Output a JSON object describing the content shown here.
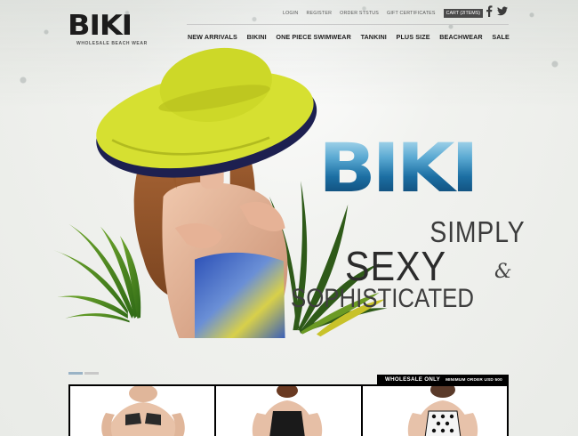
{
  "brand": {
    "logo_text": "BIKI",
    "tagline": "WHOLESALE BEACH WEAR"
  },
  "utility_nav": {
    "items": [
      {
        "label": "LOGIN"
      },
      {
        "label": "REGISTER"
      },
      {
        "label": "ORDER STSTUS"
      },
      {
        "label": "GIFT CERTIFICATES"
      }
    ],
    "cart_label": "CART (2ITEMS)",
    "social": [
      "facebook-icon",
      "twitter-icon"
    ]
  },
  "main_nav": {
    "items": [
      {
        "label": "NEW ARRIVALS"
      },
      {
        "label": "BIKINI"
      },
      {
        "label": "ONE PIECE SWIMWEAR"
      },
      {
        "label": "TANKINI"
      },
      {
        "label": "PLUS SIZE"
      },
      {
        "label": "BEACHWEAR"
      },
      {
        "label": "SALE"
      }
    ]
  },
  "hero": {
    "headline": "BIKI",
    "slogan_line1": "SIMPLY",
    "slogan_line2": "SEXY",
    "slogan_amp": "&",
    "slogan_line3": "SOPHISTICATED",
    "slides": 2,
    "active_slide": 1
  },
  "wholesale": {
    "label": "WHOLESALE ONLY",
    "minimum": "MINIMUM ORDER USD 500"
  },
  "products": [
    {
      "name": "bikini-product-thumb"
    },
    {
      "name": "one-piece-product-thumb"
    },
    {
      "name": "polka-dot-product-thumb"
    }
  ],
  "colors": {
    "hat": "#d6e031",
    "nav_text": "#1d1d1d",
    "brand_blue": "#1c6fa3",
    "bar": "#000000"
  }
}
